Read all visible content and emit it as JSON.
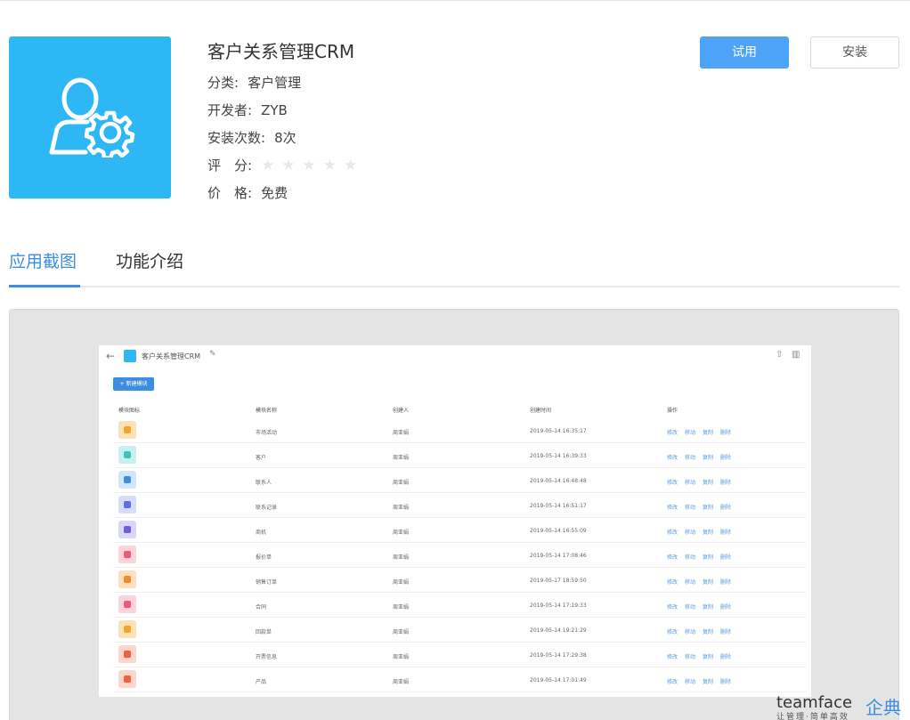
{
  "app": {
    "title": "客户关系管理CRM",
    "icon": "user-gear-icon",
    "icon_bg": "#2db7f5",
    "category_label": "分类:",
    "category_value": "客户管理",
    "developer_label": "开发者:",
    "developer_value": "ZYB",
    "installs_label": "安装次数:",
    "installs_value": "8次",
    "rating_label": "评　分:",
    "rating_value": 0,
    "rating_max": 5,
    "price_label": "价　格:",
    "price_value": "免费"
  },
  "actions": {
    "try_label": "试用",
    "install_label": "安装",
    "accent": "#4da3f7"
  },
  "tabs": [
    {
      "label": "应用截图",
      "active": true
    },
    {
      "label": "功能介绍",
      "active": false
    }
  ],
  "screenshot": {
    "title": "客户关系管理CRM",
    "new_button": "+ 新建模块",
    "columns": [
      "模块图标",
      "模块名称",
      "创建人",
      "创建时间",
      "操作"
    ],
    "rows": [
      {
        "icon_color": "#fde2b8",
        "dot": "#f5a623",
        "name": "市场活动",
        "creator": "周亚娟",
        "time": "2019-05-14 16:35:17",
        "ops": [
          "修改",
          "移动",
          "复制",
          "删除"
        ]
      },
      {
        "icon_color": "#c8f0ee",
        "dot": "#3cc5c0",
        "name": "客户",
        "creator": "周亚娟",
        "time": "2019-05-14 16:39:33",
        "ops": [
          "修改",
          "移动",
          "复制",
          "删除"
        ]
      },
      {
        "icon_color": "#cfe6fb",
        "dot": "#3d8ee0",
        "name": "联系人",
        "creator": "周亚娟",
        "time": "2019-05-14 16:48:48",
        "ops": [
          "修改",
          "移动",
          "复制",
          "删除"
        ]
      },
      {
        "icon_color": "#d6dcfa",
        "dot": "#5c6fe0",
        "name": "联系记录",
        "creator": "周亚娟",
        "time": "2019-05-14 16:51:17",
        "ops": [
          "修改",
          "移动",
          "复制",
          "删除"
        ]
      },
      {
        "icon_color": "#d9d6f7",
        "dot": "#6a5fd8",
        "name": "商机",
        "creator": "周亚娟",
        "time": "2019-05-14 16:55:09",
        "ops": [
          "修改",
          "移动",
          "复制",
          "删除"
        ]
      },
      {
        "icon_color": "#fcd3dc",
        "dot": "#ef5a7a",
        "name": "报价单",
        "creator": "周亚娟",
        "time": "2019-05-14 17:08:46",
        "ops": [
          "修改",
          "移动",
          "复制",
          "删除"
        ]
      },
      {
        "icon_color": "#fde0bf",
        "dot": "#f58a23",
        "name": "销售订单",
        "creator": "周亚娟",
        "time": "2019-05-17 18:59:50",
        "ops": [
          "修改",
          "移动",
          "复制",
          "删除"
        ]
      },
      {
        "icon_color": "#fcd3dc",
        "dot": "#ef5a7a",
        "name": "合同",
        "creator": "周亚娟",
        "time": "2019-05-14 17:19:33",
        "ops": [
          "修改",
          "移动",
          "复制",
          "删除"
        ]
      },
      {
        "icon_color": "#fde2b8",
        "dot": "#f5a623",
        "name": "回款单",
        "creator": "周亚娟",
        "time": "2019-05-14 19:21:29",
        "ops": [
          "修改",
          "移动",
          "复制",
          "删除"
        ]
      },
      {
        "icon_color": "#fdd6cc",
        "dot": "#f2603e",
        "name": "开票信息",
        "creator": "周亚娟",
        "time": "2019-05-14 17:29:38",
        "ops": [
          "修改",
          "移动",
          "复制",
          "删除"
        ]
      },
      {
        "icon_color": "#fdd6cc",
        "dot": "#f2603e",
        "name": "产品",
        "creator": "周亚娟",
        "time": "2019-05-14 17:01:49",
        "ops": [
          "修改",
          "移动",
          "复制",
          "删除"
        ]
      }
    ]
  },
  "watermark": {
    "brand": "teamface",
    "cn": "企典",
    "slogan": "让管理·简单高效"
  }
}
